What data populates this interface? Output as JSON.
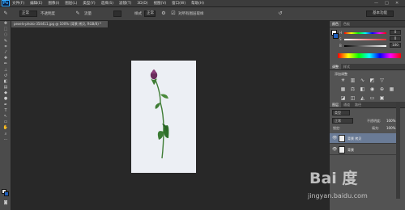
{
  "app": {
    "logo": "Ps"
  },
  "menu": [
    "文件(F)",
    "编辑(E)",
    "图像(I)",
    "图层(L)",
    "类型(Y)",
    "选择(S)",
    "滤镜(T)",
    "3D(D)",
    "视图(V)",
    "窗口(W)",
    "帮助(H)"
  ],
  "window_controls": {
    "minimize": "—",
    "maximize": "□",
    "close": "✕"
  },
  "options": {
    "mode": "正常",
    "opacity_label": "不透明度",
    "flow_label": "流量",
    "style_label": "样式",
    "style_value": "正常",
    "sample_label": "对所有图层取样",
    "workspace": "基本功能"
  },
  "document": {
    "tab_title": "pexels-photo-354411.jpg @ 100% (背景 拷贝, RGB/8) *"
  },
  "color_panel": {
    "tabs": [
      "颜色",
      "色板"
    ],
    "rows": [
      {
        "label": "H",
        "value": "0"
      },
      {
        "label": "S",
        "value": "0"
      },
      {
        "label": "B",
        "value": "100"
      }
    ]
  },
  "adjust_panel": {
    "tabs": [
      "调整",
      "样式"
    ],
    "title": "添加调整"
  },
  "layers_panel": {
    "tabs": [
      "图层",
      "通道",
      "路径"
    ],
    "kind": "类型",
    "blend": "正常",
    "opacity_label": "不透明度:",
    "opacity": "100%",
    "lock_label": "锁定:",
    "fill_label": "填充:",
    "fill": "100%",
    "layers": [
      {
        "name": "背景 拷贝",
        "selected": true
      },
      {
        "name": "背景",
        "selected": false
      }
    ]
  },
  "watermark": {
    "logo": "Bai 度",
    "url": "jingyan.baidu.com"
  }
}
